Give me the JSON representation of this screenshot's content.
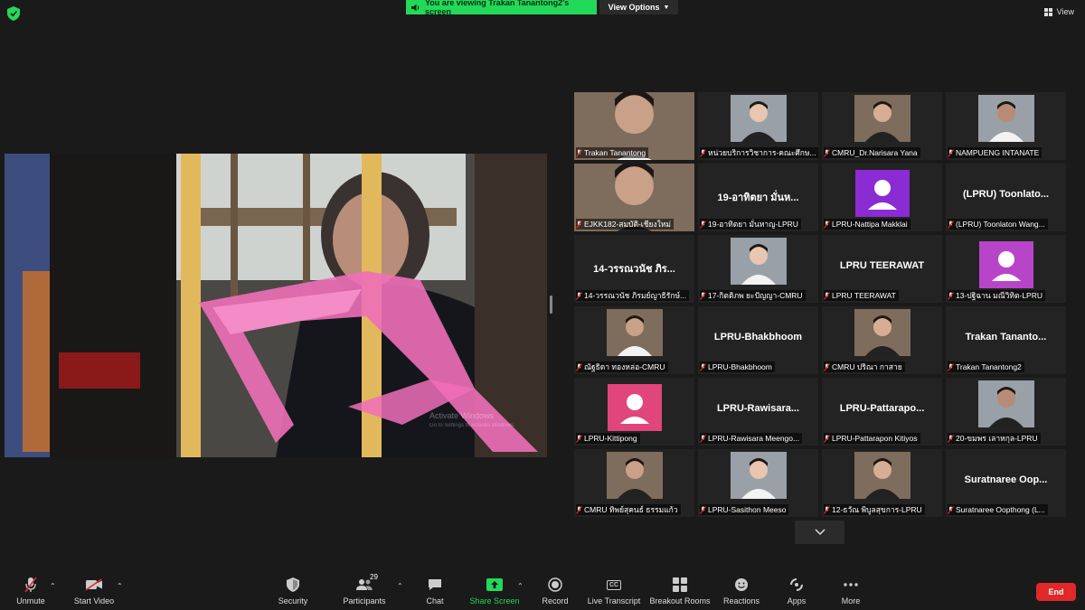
{
  "banner": {
    "text": "You are viewing Trakan Tanantong2's screen",
    "view_options": "View Options"
  },
  "view_toggle": {
    "label": "View"
  },
  "overlay": {
    "activate_windows": "Activate Windows",
    "activate_hint": "Go to Settings to activate Windows."
  },
  "participants": [
    {
      "label": "Trakan Tanantong",
      "video": true,
      "active": true
    },
    {
      "label": "หน่วยบริการวิชาการ-คณะศึกษ...",
      "video": true
    },
    {
      "label": "CMRU_Dr.Narisara Yana",
      "video": true
    },
    {
      "label": "NAMPUENG INTANATE",
      "video": true
    },
    {
      "label": "EJKK182-สมบัติ-เชียงใหม่",
      "video": true
    },
    {
      "label": "19-อาทิตยา มั่นหาญ-LPRU",
      "big": "19-อาทิตยา มั่นห..."
    },
    {
      "label": "LPRU-Nattipa Makklai",
      "avatar": "#8a2bd3"
    },
    {
      "label": "(LPRU) Toonlaton Wang...",
      "big": "(LPRU)  Toonlato..."
    },
    {
      "label": "14-วรรณวนัช ภิรมย์ญาธิรักษ์...",
      "big": "14-วรรณวนัช ภิร..."
    },
    {
      "label": "17-กิตติภพ ยะปัญญา-CMRU",
      "video": true
    },
    {
      "label": "LPRU TEERAWAT",
      "big": "LPRU TEERAWAT"
    },
    {
      "label": "13-ปฐิฉาน  มณีวิทิต-LPRU",
      "avatar": "#b845c9"
    },
    {
      "label": "ณัฐธิดา ทองหล่อ-CMRU",
      "video": true
    },
    {
      "label": "LPRU-Bhakbhoom",
      "big": "LPRU-Bhakbhoom"
    },
    {
      "label": "CMRU ปริณา กาสาย",
      "video": true
    },
    {
      "label": "Trakan Tanantong2",
      "big": "Trakan  Tananto..."
    },
    {
      "label": "LPRU-Kittipong",
      "avatar": "#e0457c"
    },
    {
      "label": "LPRU-Rawisara Meengo...",
      "big": "LPRU-Rawisara..."
    },
    {
      "label": "LPRU-Pattarapon Kitiyos",
      "big": "LPRU-Pattarapo..."
    },
    {
      "label": "20-ขมพร เลาหกุล-LPRU",
      "video": true
    },
    {
      "label": "CMRU ทิพย์สุคนธ์ ธรรมแก้ว",
      "video": true
    },
    {
      "label": "LPRU-Sasithon Meeso",
      "video": true
    },
    {
      "label": "12-ธวัณ พิบูลสุขการ-LPRU",
      "video": true
    },
    {
      "label": "Suratnaree Oopthong (L...",
      "big": "Suratnaree  Oop..."
    }
  ],
  "toolbar": {
    "unmute": "Unmute",
    "start_video": "Start Video",
    "security": "Security",
    "participants": "Participants",
    "participants_count": "29",
    "chat": "Chat",
    "share_screen": "Share Screen",
    "record": "Record",
    "live_transcript": "Live Transcript",
    "cc_badge": "CC",
    "breakout_rooms": "Breakout Rooms",
    "reactions": "Reactions",
    "apps": "Apps",
    "more": "More",
    "end": "End"
  }
}
